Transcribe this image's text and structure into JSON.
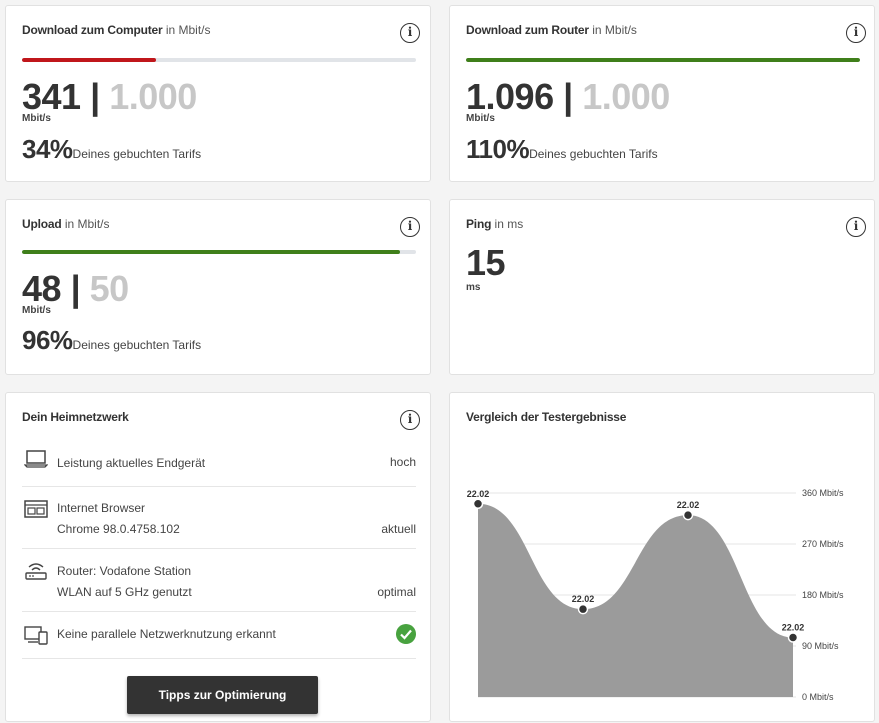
{
  "download_computer": {
    "title": "Download zum Computer",
    "unit_label": "in Mbit/s",
    "measured": "341",
    "separator": "|",
    "booked": "1.000",
    "unit": "Mbit/s",
    "percent": "34%",
    "percent_text": "Deines gebuchten Tarifs",
    "progress": 0.34,
    "bar_color": "#c0161b"
  },
  "download_router": {
    "title": "Download zum Router",
    "unit_label": "in Mbit/s",
    "measured": "1.096",
    "separator": "|",
    "booked": "1.000",
    "unit": "Mbit/s",
    "percent": "110%",
    "percent_text": "Deines gebuchten Tarifs",
    "progress": 1.0,
    "bar_color": "#3f7f1a"
  },
  "upload": {
    "title": "Upload",
    "unit_label": "in Mbit/s",
    "measured": "48",
    "separator": "|",
    "booked": "50",
    "unit": "Mbit/s",
    "percent": "96%",
    "percent_text": "Deines gebuchten Tarifs",
    "progress": 0.96,
    "bar_color": "#3f7f1a"
  },
  "ping": {
    "title": "Ping",
    "unit_label": "in ms",
    "value": "15",
    "unit": "ms"
  },
  "home_network": {
    "title": "Dein Heimnetzwerk",
    "rows": [
      {
        "icon": "laptop-icon",
        "line1": "Leistung aktuelles Endgerät",
        "line2": "",
        "value": "hoch"
      },
      {
        "icon": "browser-icon",
        "line1": "Internet Browser",
        "line2": "Chrome 98.0.4758.102",
        "value": "aktuell"
      },
      {
        "icon": "router-icon",
        "line1": "Router: Vodafone Station",
        "line2": "WLAN auf 5 GHz genutzt",
        "value": "optimal"
      },
      {
        "icon": "devices-icon",
        "line1": "Keine parallele Netzwerknutzung erkannt",
        "line2": "",
        "value": ""
      }
    ],
    "button_label": "Tipps zur Optimierung",
    "check_color": "#48a23f"
  },
  "chart_data": {
    "type": "area",
    "title": "Vergleich der Testergebnisse",
    "point_labels": [
      "22.02",
      "22.02",
      "22.02",
      "22.02"
    ],
    "values": [
      341,
      155,
      321,
      105
    ],
    "y_ticks": [
      "0 Mbit/s",
      "90 Mbit/s",
      "180 Mbit/s",
      "270 Mbit/s",
      "360 Mbit/s"
    ],
    "ylim": [
      0,
      360
    ],
    "grid": true,
    "fill_color": "#9b9b9b"
  }
}
